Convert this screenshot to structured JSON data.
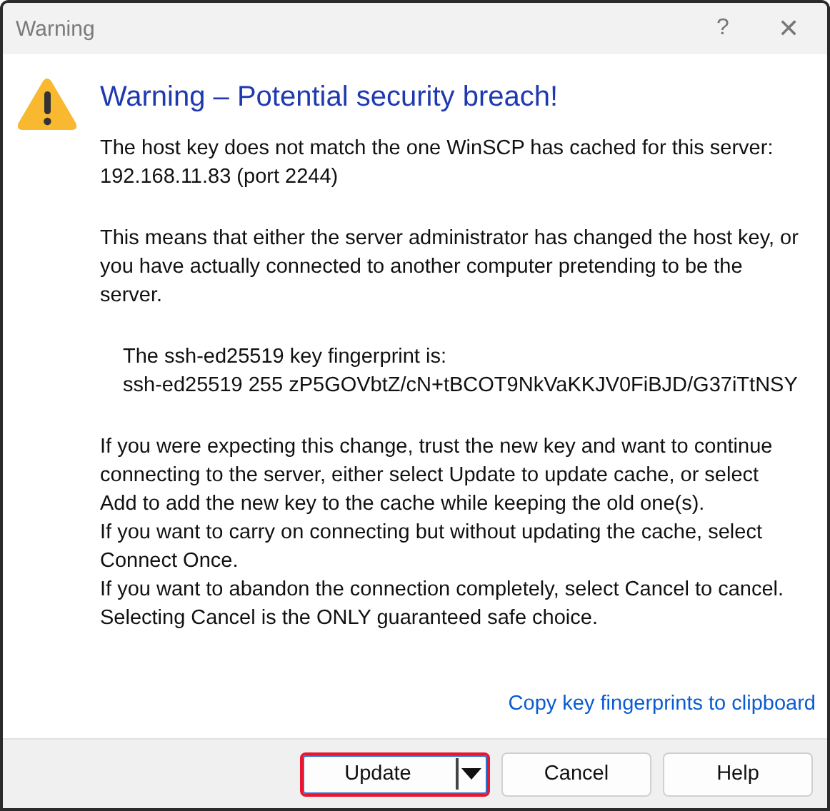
{
  "window": {
    "title": "Warning",
    "help_glyph": "?",
    "close_glyph": "✕"
  },
  "heading": "Warning – Potential security breach!",
  "paragraphs": [
    {
      "kind": "text",
      "lines": [
        "The host key does not match the one WinSCP has cached for this server:",
        "192.168.11.83 (port 2244)"
      ]
    },
    {
      "kind": "text",
      "lines": [
        "This means that either the server administrator has changed the host key, or",
        "you have actually connected to another computer pretending to be the",
        "server."
      ]
    },
    {
      "kind": "indented",
      "lines": [
        "The ssh-ed25519 key fingerprint is:",
        "ssh-ed25519 255 zP5GOVbtZ/cN+tBCOT9NkVaKKJV0FiBJD/G37iTtNSY"
      ]
    },
    {
      "kind": "text",
      "lines": [
        "If you were expecting this change, trust the new key and want to continue",
        "connecting to the server, either select Update to update cache, or select",
        "Add to add the new key to the cache while keeping the old one(s).",
        "If you want to carry on connecting but without updating the cache, select",
        "Connect Once.",
        "If you want to abandon the connection completely, select Cancel to cancel.",
        "Selecting Cancel is the ONLY guaranteed safe choice."
      ]
    }
  ],
  "link": "Copy key fingerprints to clipboard",
  "buttons": [
    {
      "label": "Update",
      "kind": "split",
      "highlighted": true
    },
    {
      "label": "Cancel",
      "kind": "plain",
      "highlighted": false
    },
    {
      "label": "Help",
      "kind": "plain",
      "highlighted": false
    }
  ]
}
